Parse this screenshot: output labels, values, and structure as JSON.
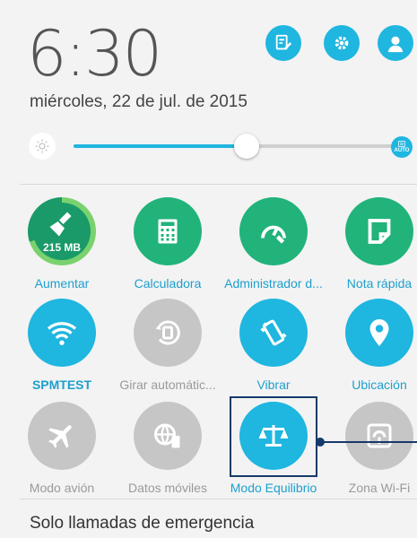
{
  "header": {
    "time": "6:30",
    "date": "miércoles, 22 de jul. de 2015"
  },
  "brightness": {
    "level": 0.54,
    "auto_label": "AUTO"
  },
  "tiles": [
    {
      "label": "Aumentar",
      "icon": "broom-icon",
      "badge": "215 MB",
      "state": "green"
    },
    {
      "label": "Calculadora",
      "icon": "calculator-icon",
      "state": "green"
    },
    {
      "label": "Administrador d...",
      "icon": "speedometer-wrench-icon",
      "state": "green"
    },
    {
      "label": "Nota rápida",
      "icon": "note-icon",
      "state": "green"
    },
    {
      "label": "SPMTEST",
      "icon": "wifi-icon",
      "state": "on"
    },
    {
      "label": "Girar automátic...",
      "icon": "auto-rotate-icon",
      "state": "off"
    },
    {
      "label": "Vibrar",
      "icon": "vibrate-icon",
      "state": "on"
    },
    {
      "label": "Ubicación",
      "icon": "location-pin-icon",
      "state": "on"
    },
    {
      "label": "Modo avión",
      "icon": "airplane-icon",
      "state": "off"
    },
    {
      "label": "Datos móviles",
      "icon": "mobile-data-icon",
      "state": "off"
    },
    {
      "label": "Modo Equilibrio",
      "icon": "balance-scale-icon",
      "state": "on"
    },
    {
      "label": "Zona Wi-Fi",
      "icon": "hotspot-icon",
      "state": "off"
    }
  ],
  "footer": {
    "status": "Solo llamadas de emergencia"
  },
  "colors": {
    "accent": "#1fb6e0",
    "green": "#21b37a",
    "disabled": "#c6c6c6",
    "highlight": "#163a6b"
  }
}
